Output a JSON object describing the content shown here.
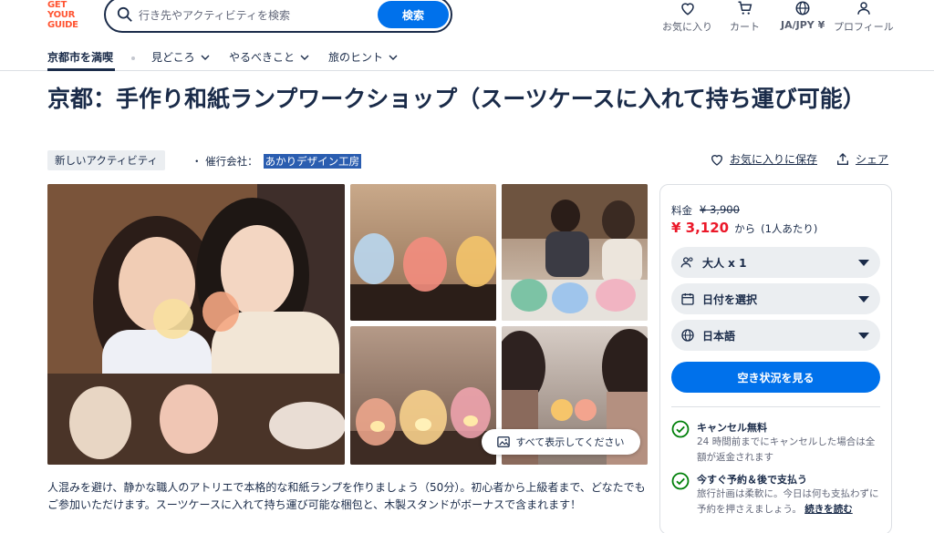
{
  "header": {
    "logo": [
      "GET",
      "YOUR",
      "GUIDE"
    ],
    "search_placeholder": "行き先やアクティビティを検索",
    "search_button": "検索",
    "nav": [
      {
        "label": "お気に入り",
        "icon": "heart-icon"
      },
      {
        "label": "カート",
        "icon": "cart-icon"
      },
      {
        "label": "JA/JPY ¥",
        "icon": "globe-icon"
      },
      {
        "label": "プロフィール",
        "icon": "person-icon"
      }
    ]
  },
  "subnav": {
    "items": [
      "京都市を満喫",
      "見どころ",
      "やるべきこと",
      "旅のヒント"
    ]
  },
  "title": "京都：手作り和紙ランプワークショップ（スーツケースに入れて持ち運び可能）",
  "badge": "新しいアクティビティ",
  "provider": {
    "label": "・ 催行会社：",
    "name": "あかりデザイン工房"
  },
  "actions": {
    "save": "お気に入りに保存",
    "share": "シェア"
  },
  "gallery": {
    "show_all": "すべて表示してください"
  },
  "description": "人混みを避け、静かな職人のアトリエで本格的な和紙ランプを作りましょう（50分）。初心者から上級者まで、どなたでもご参加いただけます。スーツケースに入れて持ち運び可能な梱包と、木製スタンドがボーナスで含まれます！",
  "booking": {
    "price_label": "料金",
    "old_price": "¥ 3,900",
    "price": "¥ 3,120",
    "from": "から",
    "per": "(1人あたり)",
    "participants": "大人 x 1",
    "date": "日付を選択",
    "language": "日本語",
    "availability_button": "空き状況を見る",
    "features": [
      {
        "title": "キャンセル無料",
        "desc": "24 時間前までにキャンセルした場合は全額が返金されます"
      },
      {
        "title": "今すぐ予約＆後で支払う",
        "desc": "旅行計画は柔軟に。今日は何も支払わずに予約を押さえましょう。",
        "link": "続きを読む"
      }
    ]
  },
  "colors": {
    "brand": "#ff5533",
    "primary": "#0071eb",
    "price_red": "#eb1829",
    "text": "#1a2b49",
    "check": "#008009"
  }
}
